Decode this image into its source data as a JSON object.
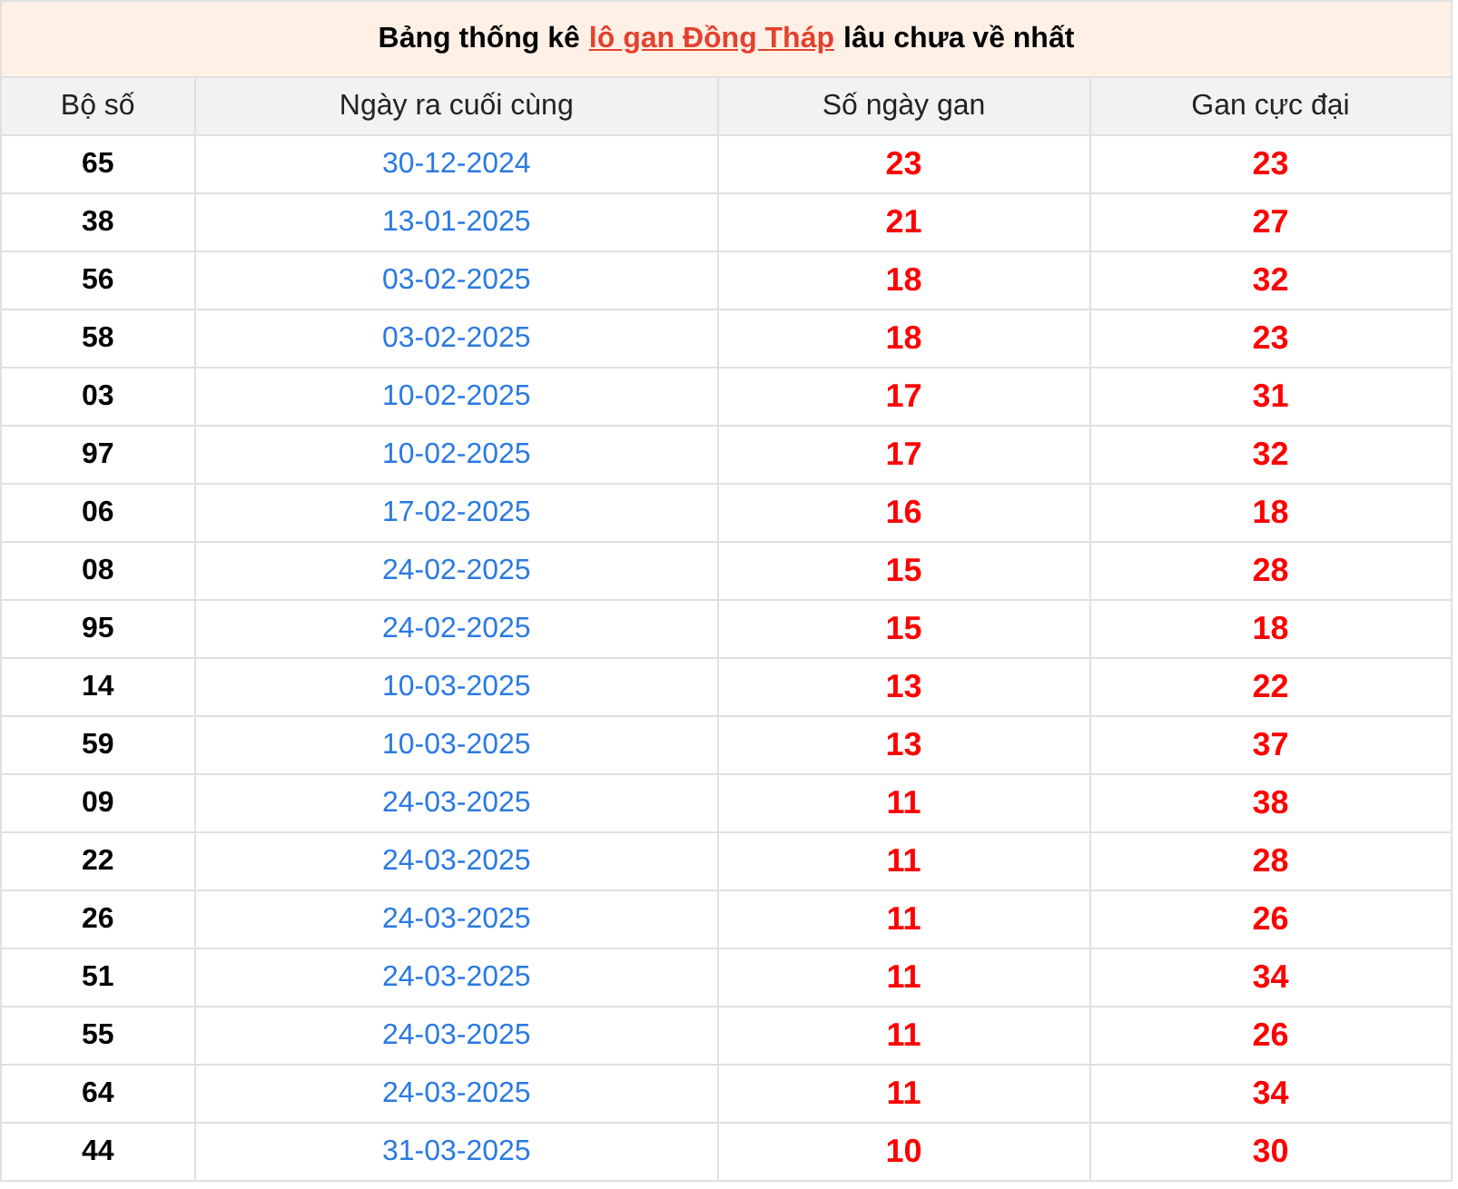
{
  "title": {
    "before": "Bảng thống kê",
    "link": "lô gan Đồng Tháp",
    "after": "lâu chưa về nhất"
  },
  "table": {
    "columns": [
      "Bộ số",
      "Ngày ra cuối cùng",
      "Số ngày gan",
      "Gan cực đại"
    ],
    "rows": [
      [
        "65",
        "30-12-2024",
        "23",
        "23"
      ],
      [
        "38",
        "13-01-2025",
        "21",
        "27"
      ],
      [
        "56",
        "03-02-2025",
        "18",
        "32"
      ],
      [
        "58",
        "03-02-2025",
        "18",
        "23"
      ],
      [
        "03",
        "10-02-2025",
        "17",
        "31"
      ],
      [
        "97",
        "10-02-2025",
        "17",
        "32"
      ],
      [
        "06",
        "17-02-2025",
        "16",
        "18"
      ],
      [
        "08",
        "24-02-2025",
        "15",
        "28"
      ],
      [
        "95",
        "24-02-2025",
        "15",
        "18"
      ],
      [
        "14",
        "10-03-2025",
        "13",
        "22"
      ],
      [
        "59",
        "10-03-2025",
        "13",
        "37"
      ],
      [
        "09",
        "24-03-2025",
        "11",
        "38"
      ],
      [
        "22",
        "24-03-2025",
        "11",
        "28"
      ],
      [
        "26",
        "24-03-2025",
        "11",
        "26"
      ],
      [
        "51",
        "24-03-2025",
        "11",
        "34"
      ],
      [
        "55",
        "24-03-2025",
        "11",
        "26"
      ],
      [
        "64",
        "24-03-2025",
        "11",
        "34"
      ],
      [
        "44",
        "31-03-2025",
        "10",
        "30"
      ]
    ]
  }
}
